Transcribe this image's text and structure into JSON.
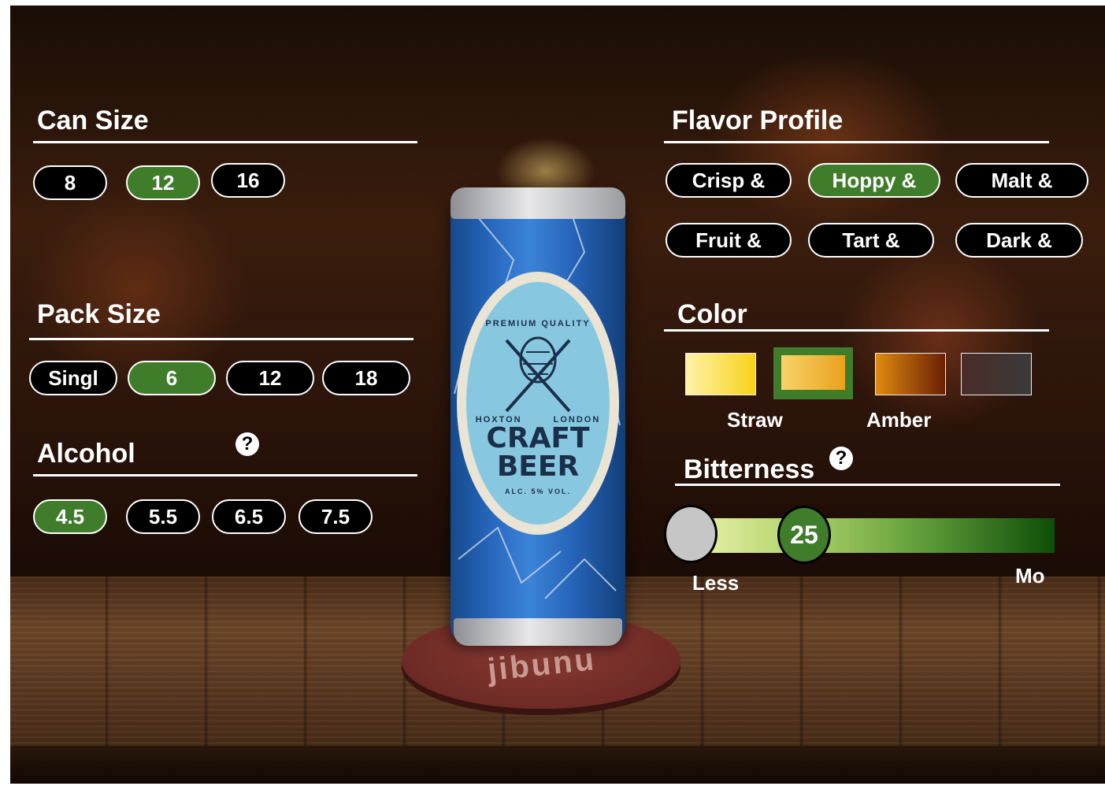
{
  "can_size": {
    "title": "Can Size",
    "options": [
      "8",
      "12",
      "16"
    ],
    "selected": "12"
  },
  "pack_size": {
    "title": "Pack Size",
    "options": [
      "Singl",
      "6",
      "12",
      "18"
    ],
    "selected": "6"
  },
  "alcohol": {
    "title": "Alcohol",
    "help": "?",
    "options": [
      "4.5",
      "5.5",
      "6.5",
      "7.5"
    ],
    "selected": "4.5"
  },
  "flavor_profile": {
    "title": "Flavor Profile",
    "options": [
      "Crisp &",
      "Hoppy &",
      "Malt &",
      "Fruit &",
      "Tart &",
      "Dark &"
    ],
    "selected": "Hoppy &"
  },
  "color": {
    "title": "Color",
    "swatches": [
      {
        "name": "straw",
        "from": "#fff2a8",
        "to": "#f7d21a"
      },
      {
        "name": "gold",
        "from": "#f8d36a",
        "to": "#e9a01e"
      },
      {
        "name": "amber",
        "from": "#e08a10",
        "to": "#6a1f04"
      },
      {
        "name": "dark",
        "from": "#4a2c28",
        "to": "#3a3a3a"
      }
    ],
    "selected_index": 1,
    "selected_border": "#3f7d2b",
    "labels": {
      "straw": "Straw",
      "amber": "Amber"
    }
  },
  "bitterness": {
    "title": "Bitterness",
    "help": "?",
    "value": "25",
    "min_label": "Less",
    "max_label": "Mo"
  },
  "product": {
    "brand_line1": "CRAFT",
    "brand_line2": "BEER",
    "tagline": "PREMIUM QUALITY",
    "left_text": "HOXTON",
    "right_text": "LONDON",
    "abv": "ALC. 5% VOL.",
    "coaster_logo": "jibunu"
  },
  "colors": {
    "accent": "#3f7d2b",
    "pill_bg": "#000000",
    "text": "#ffffff"
  }
}
